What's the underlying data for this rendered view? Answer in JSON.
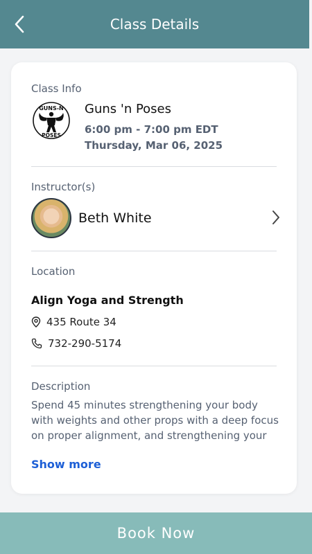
{
  "header": {
    "title": "Class Details"
  },
  "class_info": {
    "label": "Class Info",
    "name": "Guns 'n Poses",
    "time": "6:00 pm - 7:00 pm EDT",
    "date": "Thursday, Mar 06, 2025",
    "logo_text_top": "GUNS-N",
    "logo_text_bottom": "POSES"
  },
  "instructors": {
    "label": "Instructor(s)",
    "items": [
      {
        "name": "Beth White"
      }
    ]
  },
  "location": {
    "label": "Location",
    "name": "Align Yoga and Strength",
    "address": "435 Route 34",
    "phone": "732-290-5174"
  },
  "description": {
    "label": "Description",
    "text": "Spend 45 minutes strengthening your body with weights and other props with a deep focus on proper alignment, and strengthening your muscles.",
    "show_more": "Show more"
  },
  "book_button": {
    "label": "Book Now"
  }
}
